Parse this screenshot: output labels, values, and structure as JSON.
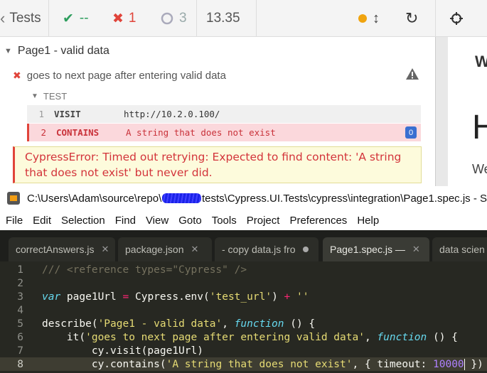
{
  "runner": {
    "header": {
      "tests_label": "Tests",
      "passed": "--",
      "failed": "1",
      "pending": "3",
      "duration": "13.35"
    },
    "suite_title": "Page1 - valid data",
    "test_title": "goes to next page after entering valid data",
    "section_label": "TEST",
    "commands": [
      {
        "number": "1",
        "name": "VISIT",
        "message": "http://10.2.0.100/"
      },
      {
        "number": "2",
        "name": "CONTAINS",
        "message": "A string that does not exist",
        "badge": "0"
      }
    ],
    "error_message": "CypressError: Timed out retrying: Expected to find content: 'A string that does not exist' but never did.",
    "preview": {
      "fragment_1": "W",
      "fragment_2": "H",
      "fragment_3": "We"
    }
  },
  "editor": {
    "title_prefix": "C:\\Users\\Adam\\source\\repo\\",
    "title_suffix": "tests\\Cypress.UI.Tests\\cypress\\integration\\Page1.spec.js - S",
    "menu": [
      "File",
      "Edit",
      "Selection",
      "Find",
      "View",
      "Goto",
      "Tools",
      "Project",
      "Preferences",
      "Help"
    ],
    "tabs": [
      {
        "label": "correctAnswers.js"
      },
      {
        "label": "package.json"
      },
      {
        "label": "- copy data.js fro"
      },
      {
        "label": "Page1.spec.js —"
      },
      {
        "label": "data scien"
      }
    ],
    "line_numbers": [
      "1",
      "2",
      "3",
      "4",
      "5",
      "6",
      "7",
      "8"
    ],
    "code": {
      "l1": "/// <reference types=\"Cypress\" />",
      "l3_kw": "var",
      "l3_a": " page1Url ",
      "l3_eq": "=",
      "l3_b": " Cypress.env(",
      "l3_s1": "'test_url'",
      "l3_c": ") ",
      "l3_plus": "+",
      "l3_sp": " ",
      "l3_s2": "''",
      "l5_a": "describe(",
      "l5_s": "'Page1 - valid data'",
      "l5_b": ", ",
      "l5_fn": "function",
      "l5_c": " () {",
      "l6_a": "    it(",
      "l6_s": "'goes to next page after entering valid data'",
      "l6_b": ", ",
      "l6_fn": "function",
      "l6_c": " () {",
      "l7": "        cy.visit(page1Url)",
      "l8_a": "        cy.contains(",
      "l8_s": "'A string that does not exist'",
      "l8_b": ", { timeout: ",
      "l8_n": "10000",
      "l8_c": " })"
    }
  },
  "colors": {
    "passed": "#2e9e5e",
    "failed": "#e0443a",
    "running": "#f0a40f",
    "badge": "#3a6fd1",
    "editor_bg": "#272822"
  }
}
